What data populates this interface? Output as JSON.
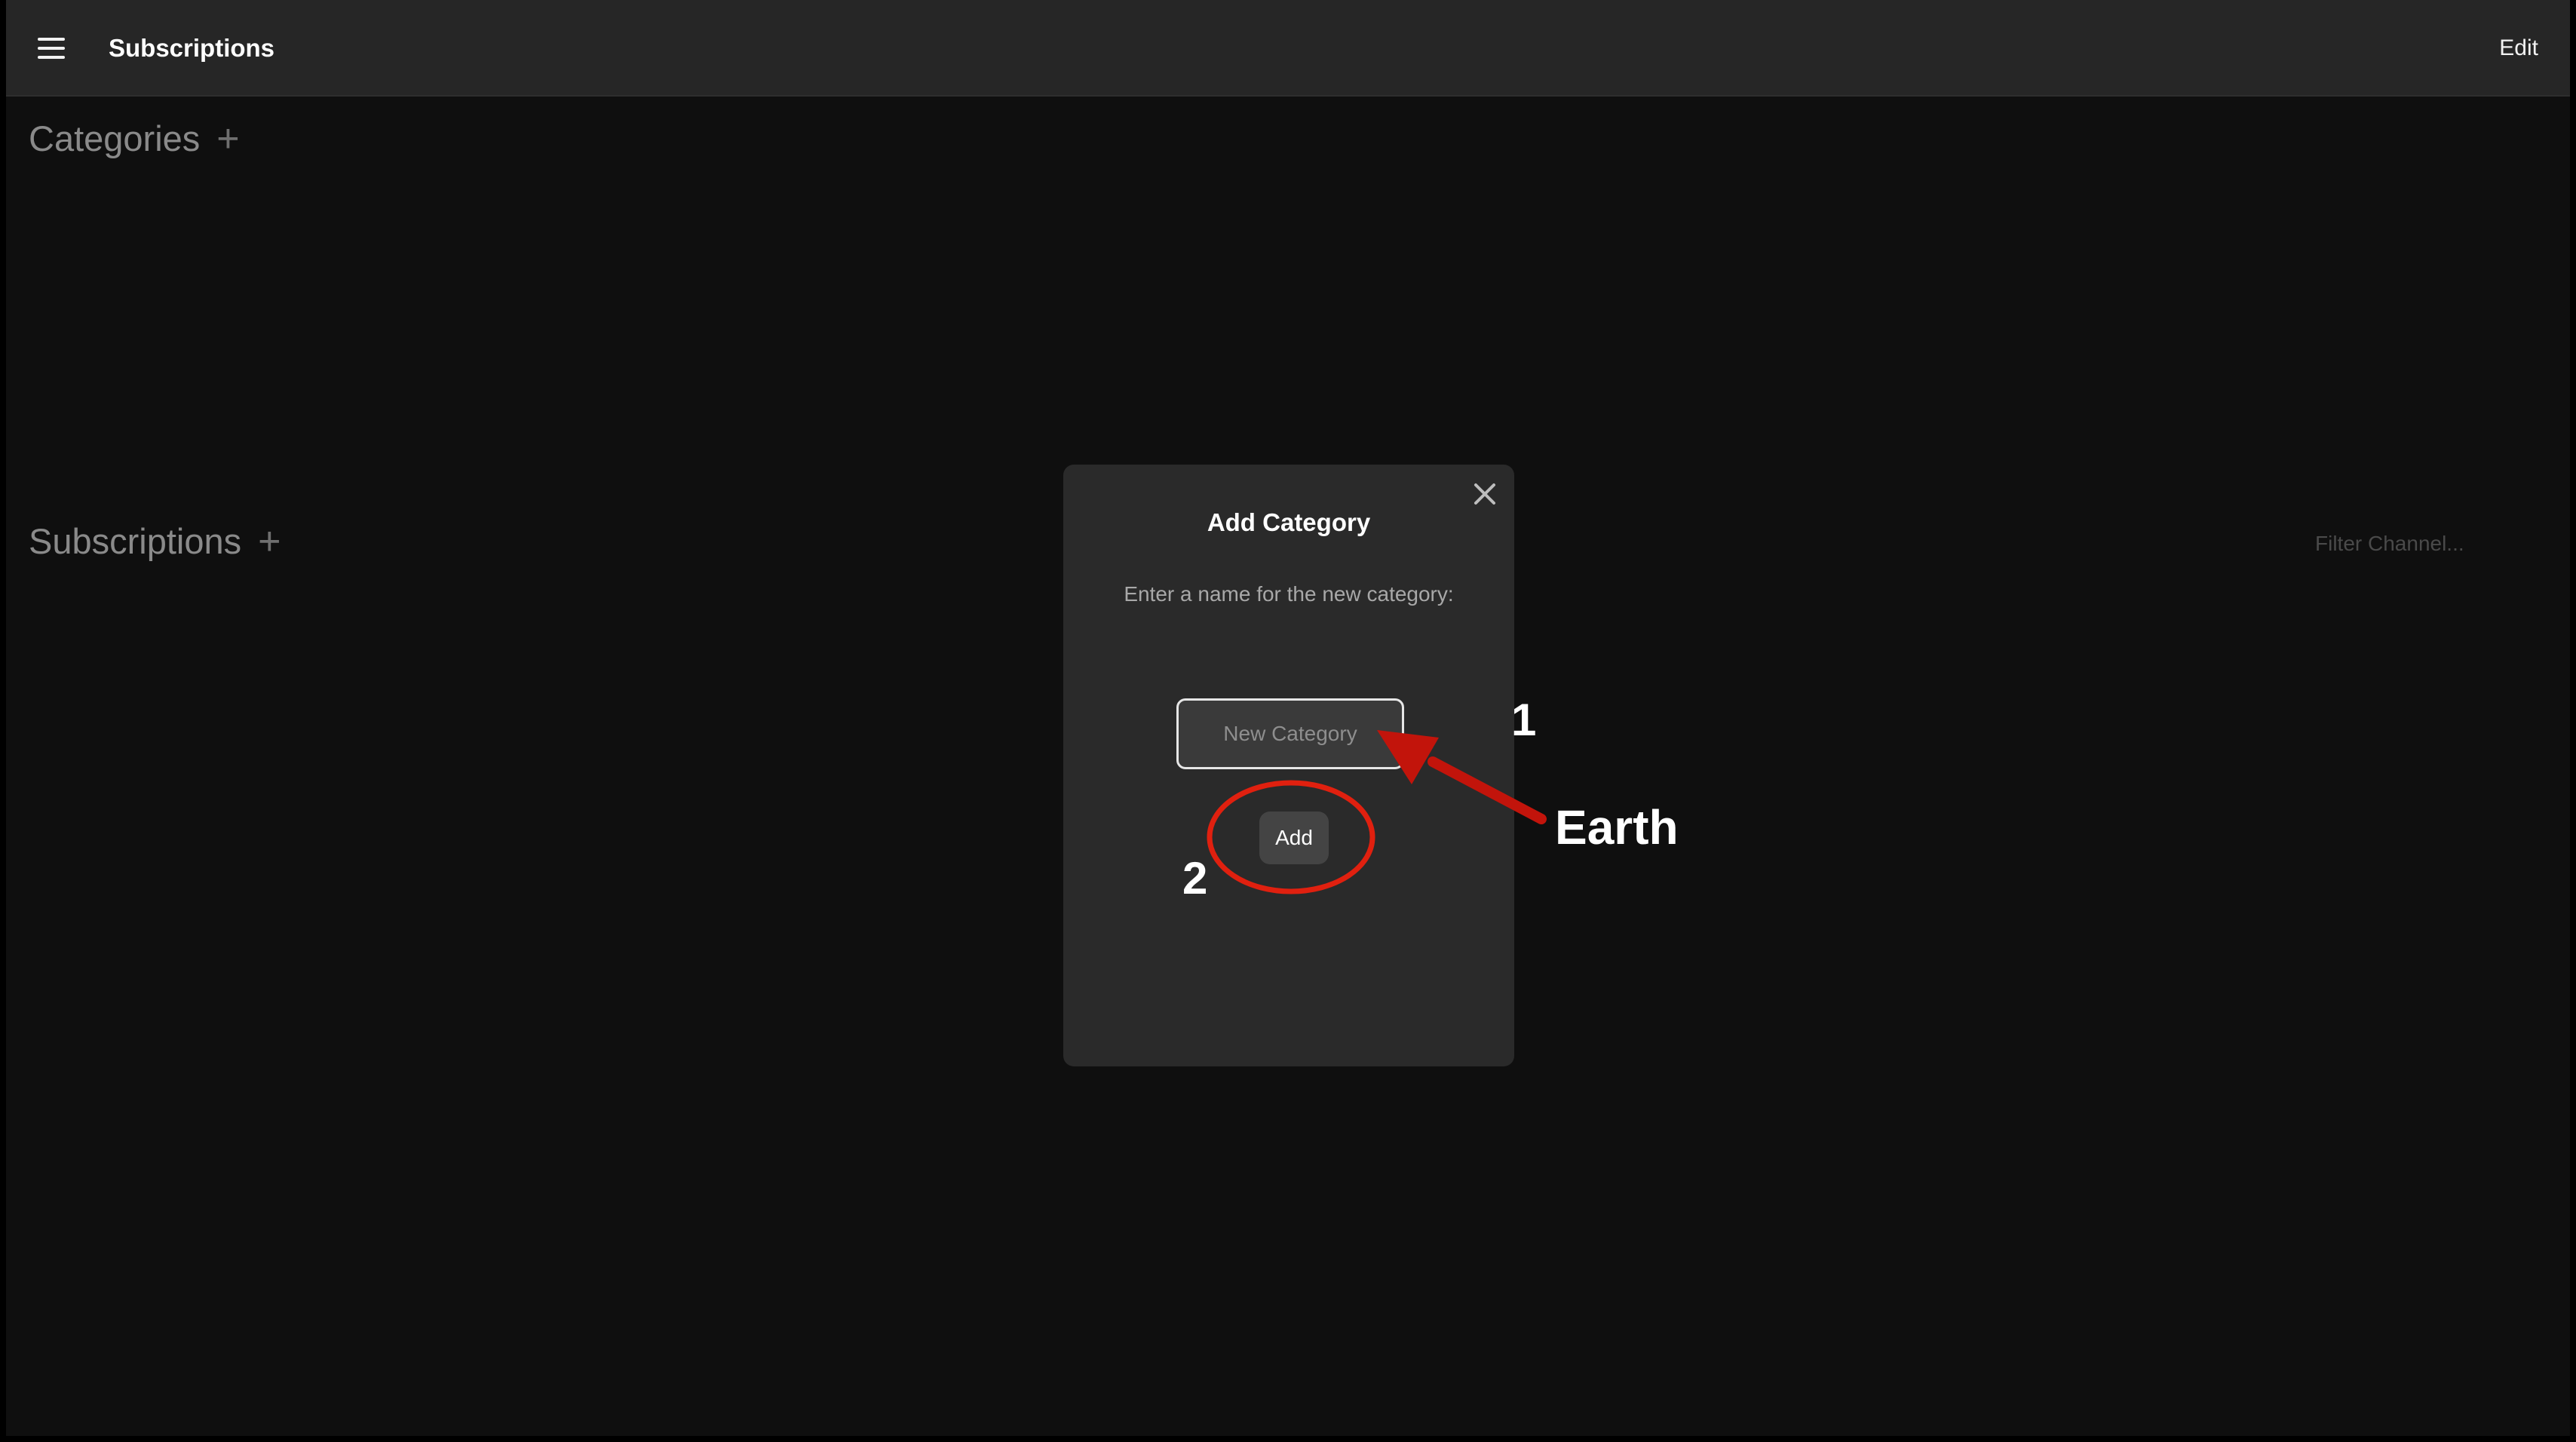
{
  "header": {
    "title": "Subscriptions",
    "menu_icon": "hamburger-menu-icon",
    "edit_label": "Edit"
  },
  "categories": {
    "title": "Categories",
    "add_symbol": "+"
  },
  "subscriptions": {
    "title": "Subscriptions",
    "add_symbol": "+",
    "filter_placeholder": "Filter Channel..."
  },
  "modal": {
    "title": "Add Category",
    "description": "Enter a name for the new category:",
    "input_placeholder": "New Category",
    "input_value": "",
    "add_label": "Add",
    "close_icon": "close-icon"
  },
  "annotations": {
    "step1": "1",
    "step2": "2",
    "earth_label": "Earth",
    "color": "#e0200f"
  },
  "colors": {
    "page_bg": "#0f0f0f",
    "topbar_bg": "#262626",
    "modal_bg": "#2a2a2a",
    "annotation_red": "#e0200f"
  }
}
